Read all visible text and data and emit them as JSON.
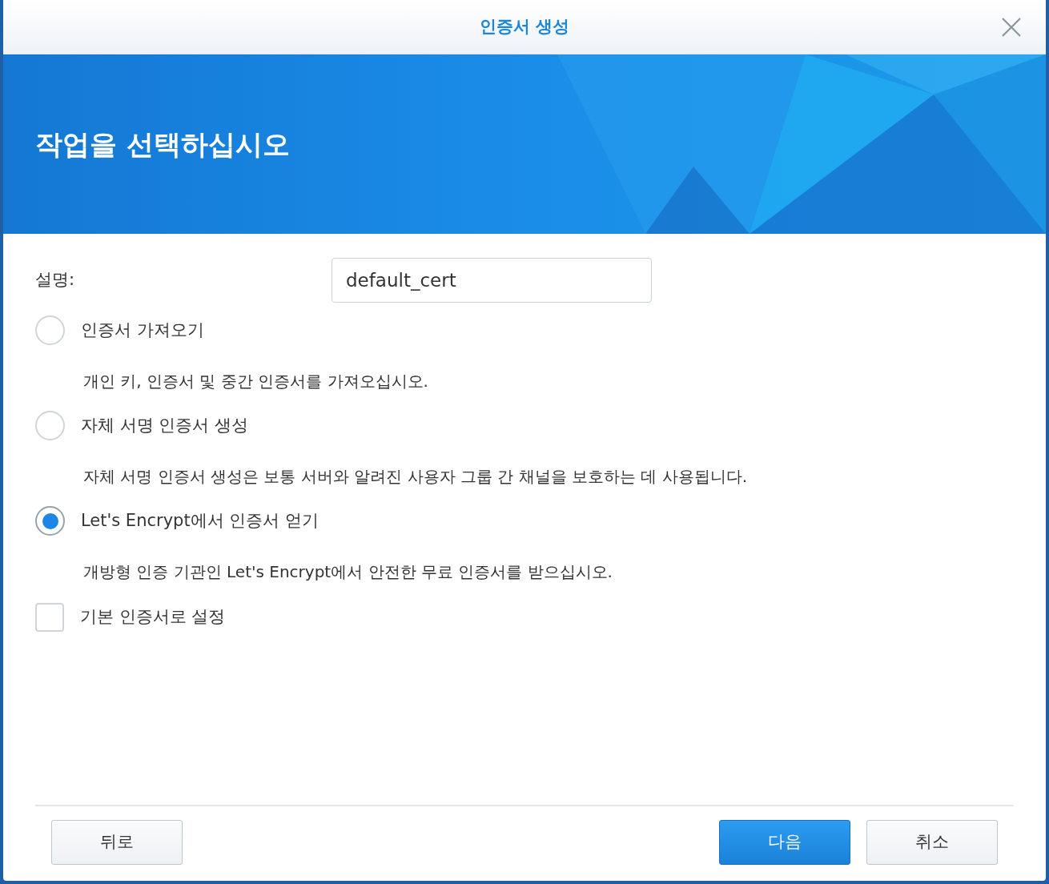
{
  "dialog": {
    "title": "인증서 생성"
  },
  "banner": {
    "heading": "작업을 선택하십시오"
  },
  "description_field": {
    "label": "설명:",
    "value": "default_cert"
  },
  "options": [
    {
      "label": "인증서 가져오기",
      "description": "개인 키, 인증서 및 중간 인증서를 가져오십시오.",
      "selected": false
    },
    {
      "label": "자체 서명 인증서 생성",
      "description": "자체 서명 인증서 생성은 보통 서버와 알려진 사용자 그룹 간 채널을 보호하는 데 사용됩니다.",
      "selected": false
    },
    {
      "label": "Let's Encrypt에서 인증서 얻기",
      "description": "개방형 인증 기관인 Let's Encrypt에서 안전한 무료 인증서를 받으십시오.",
      "selected": true
    }
  ],
  "default_checkbox": {
    "label": "기본 인증서로 설정",
    "checked": false
  },
  "buttons": [
    {
      "label": "뒤로",
      "kind": "secondary"
    },
    {
      "label": "다음",
      "kind": "primary"
    },
    {
      "label": "취소",
      "kind": "secondary"
    }
  ]
}
